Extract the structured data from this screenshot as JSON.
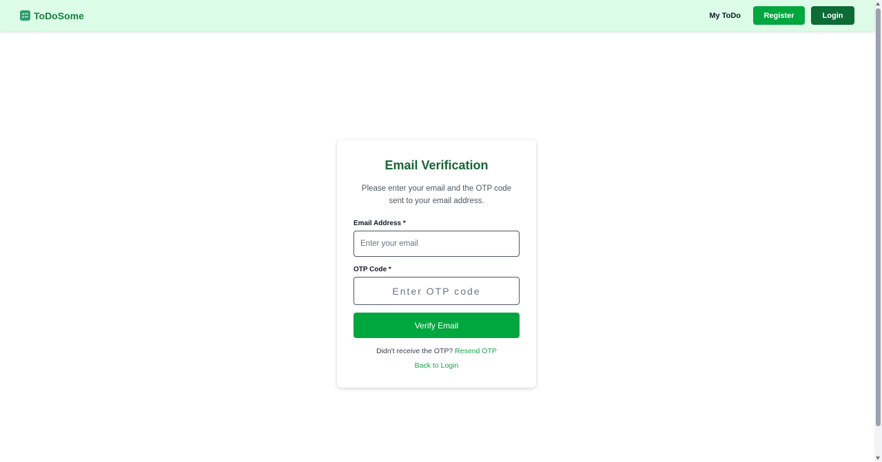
{
  "header": {
    "brand": "ToDoSome",
    "nav_link": "My ToDo",
    "register_label": "Register",
    "login_label": "Login"
  },
  "card": {
    "title": "Email Verification",
    "subtitle": "Please enter your email and the OTP code sent to your email address.",
    "email_label": "Email Address *",
    "email_placeholder": "Enter your email",
    "email_value": "",
    "otp_label": "OTP Code *",
    "otp_placeholder": "Enter OTP code",
    "otp_value": "",
    "verify_label": "Verify Email",
    "resend_prompt": "Didn't receive the OTP?",
    "resend_link": "Resend OTP",
    "back_link": "Back to Login"
  },
  "icons": {
    "brand": "checklist-icon"
  },
  "colors": {
    "header_bg": "#dcfce7",
    "brand_text": "#15803d",
    "primary_green": "#00a63e",
    "login_dark_green": "#0d6b35",
    "title_green": "#166534",
    "link_green": "#16a34a"
  }
}
